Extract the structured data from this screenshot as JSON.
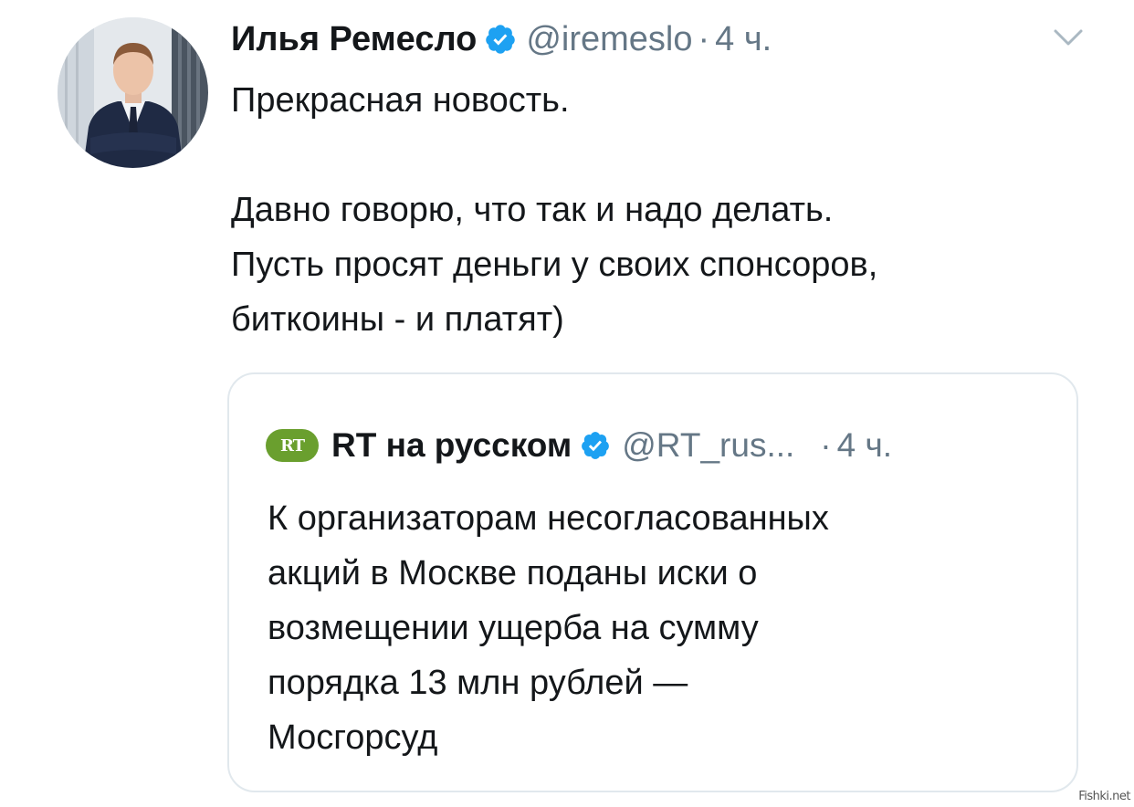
{
  "tweet": {
    "author_name": "Илья Ремесло",
    "handle": "@iremeslo",
    "separator": "·",
    "time": "4 ч.",
    "icons": {
      "verified": "verified-badge-icon",
      "menu": "chevron-down-icon",
      "avatar": "profile-photo"
    },
    "text_lines": [
      "Прекрасная новость.",
      "",
      "Давно говорю, что так и надо делать.",
      "Пусть просят деньги у своих спонсоров,",
      "биткоины - и платят)"
    ]
  },
  "quoted_tweet": {
    "logo_text": "RT",
    "author_name": "RT на русском",
    "handle": "@RT_rus...",
    "separator": "·",
    "time": "4 ч.",
    "text_lines": [
      "К организаторам несогласованных",
      "акций в Москве поданы иски о",
      "возмещении ущерба на сумму",
      "порядка 13 млн рублей —",
      "Мосгорсуд"
    ]
  },
  "watermark": "Fishki.net",
  "colors": {
    "text_primary": "#14171a",
    "text_secondary": "#657786",
    "verified_blue": "#1da1f2",
    "border": "#e1e8ed",
    "rt_green": "#6a9f2e"
  }
}
